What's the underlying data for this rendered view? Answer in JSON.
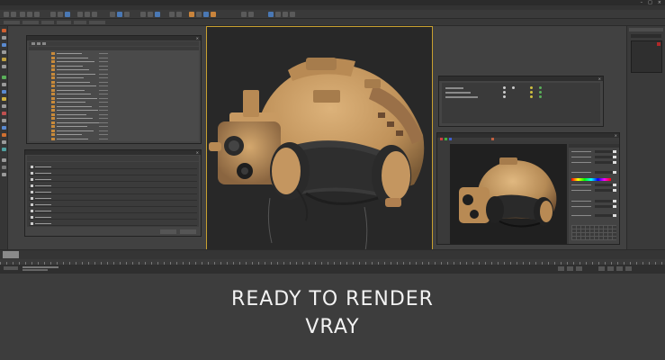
{
  "caption": {
    "line1": "READY TO RENDER",
    "line2": "VRAY"
  },
  "colors": {
    "viewport_border": "#c8a030",
    "helmet_tan": "#c89a62",
    "file_icon_orange": "#c88a3a",
    "selection_blue": "#4a78b4",
    "red_swatch": "#b02828"
  },
  "icons": {
    "close": "close-icon",
    "minimize": "minimize-icon",
    "maximize": "maximize-icon",
    "file": "file-icon",
    "layer": "layer-icon"
  },
  "render": {
    "object": "military helmet"
  }
}
